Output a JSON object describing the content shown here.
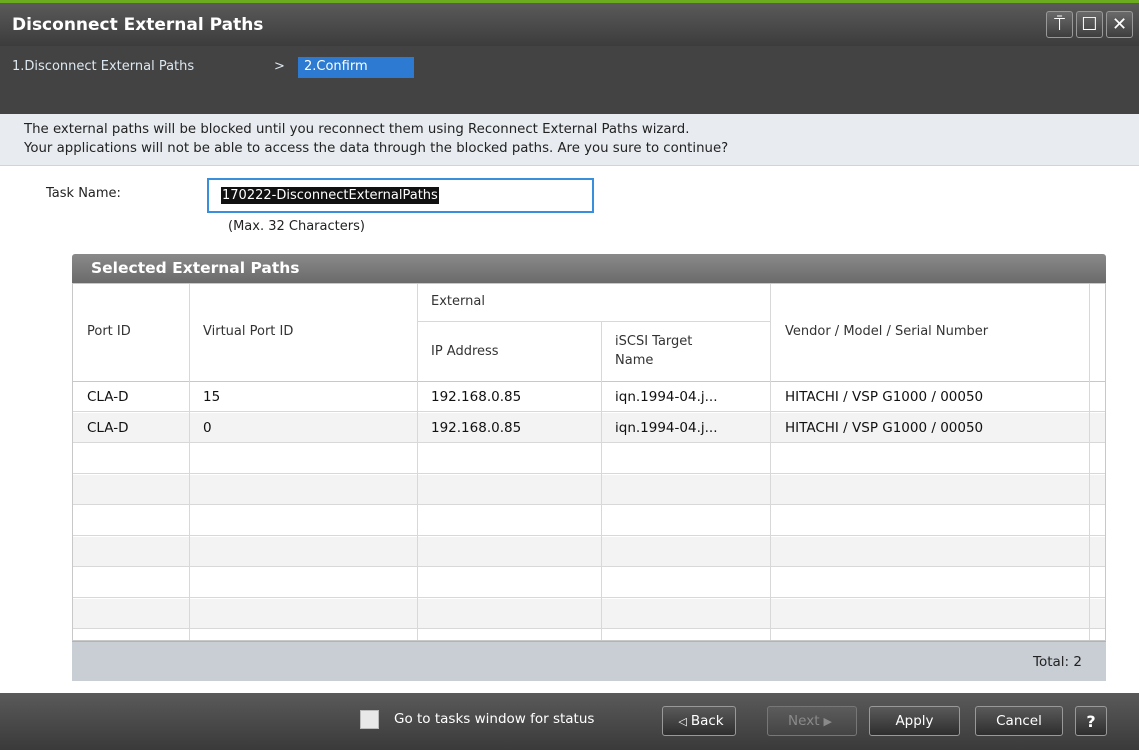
{
  "window": {
    "title": "Disconnect External Paths",
    "controls": {
      "pin": "⍑",
      "maximize": "☐",
      "close": "✕"
    }
  },
  "breadcrumb": {
    "step1": "1.Disconnect External Paths",
    "separator": ">",
    "step2": "2.Confirm"
  },
  "message": {
    "line1": "The external paths will be blocked until you reconnect them using Reconnect External Paths wizard.",
    "line2": "Your applications will not be able to access the data through the blocked paths. Are you sure to continue?"
  },
  "task": {
    "label": "Task Name:",
    "value": "170222-DisconnectExternalPaths",
    "hint": "(Max. 32 Characters)"
  },
  "table": {
    "title": "Selected External Paths",
    "headers": {
      "port_id": "Port ID",
      "virtual_port_id": "Virtual Port ID",
      "external": "External",
      "ip_address": "IP Address",
      "iscsi_target_line1": "iSCSI Target",
      "iscsi_target_line2": "Name",
      "vendor": "Vendor / Model / Serial Number"
    },
    "rows": [
      {
        "port_id": "CLA-D",
        "virtual_port_id": "15",
        "ip": "192.168.0.85",
        "iscsi": "iqn.1994-04.j...",
        "vendor": "HITACHI / VSP G1000 / 00050"
      },
      {
        "port_id": "CLA-D",
        "virtual_port_id": "0",
        "ip": "192.168.0.85",
        "iscsi": "iqn.1994-04.j...",
        "vendor": "HITACHI / VSP G1000 / 00050"
      }
    ],
    "total": "Total:  2"
  },
  "footer": {
    "checkbox_label": "Go to tasks window for status",
    "back": "Back",
    "next": "Next",
    "apply": "Apply",
    "cancel": "Cancel",
    "help": "?"
  },
  "colors": {
    "accent": "#2c7ad1",
    "title_accent": "#6aab1f"
  }
}
